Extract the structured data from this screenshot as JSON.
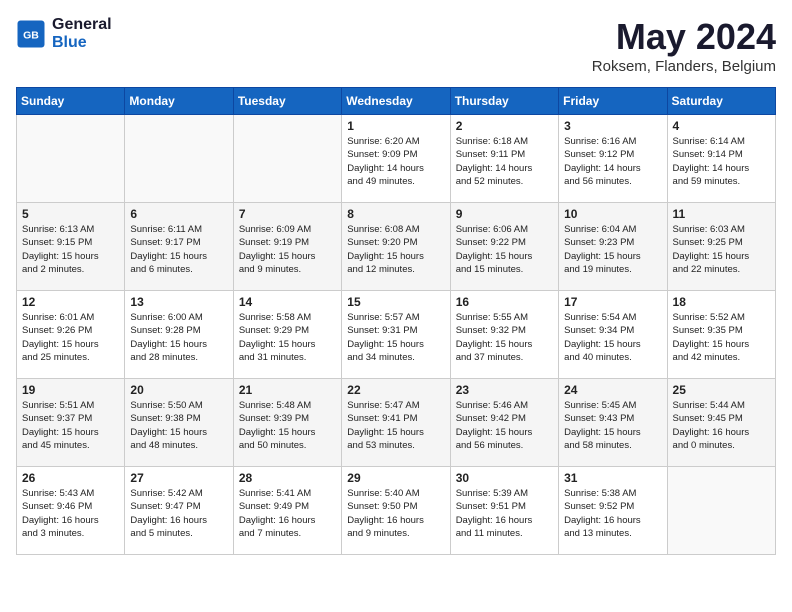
{
  "header": {
    "logo_line1": "General",
    "logo_line2": "Blue",
    "month_title": "May 2024",
    "location": "Roksem, Flanders, Belgium"
  },
  "days_of_week": [
    "Sunday",
    "Monday",
    "Tuesday",
    "Wednesday",
    "Thursday",
    "Friday",
    "Saturday"
  ],
  "weeks": [
    [
      {
        "day": "",
        "content": ""
      },
      {
        "day": "",
        "content": ""
      },
      {
        "day": "",
        "content": ""
      },
      {
        "day": "1",
        "content": "Sunrise: 6:20 AM\nSunset: 9:09 PM\nDaylight: 14 hours\nand 49 minutes."
      },
      {
        "day": "2",
        "content": "Sunrise: 6:18 AM\nSunset: 9:11 PM\nDaylight: 14 hours\nand 52 minutes."
      },
      {
        "day": "3",
        "content": "Sunrise: 6:16 AM\nSunset: 9:12 PM\nDaylight: 14 hours\nand 56 minutes."
      },
      {
        "day": "4",
        "content": "Sunrise: 6:14 AM\nSunset: 9:14 PM\nDaylight: 14 hours\nand 59 minutes."
      }
    ],
    [
      {
        "day": "5",
        "content": "Sunrise: 6:13 AM\nSunset: 9:15 PM\nDaylight: 15 hours\nand 2 minutes."
      },
      {
        "day": "6",
        "content": "Sunrise: 6:11 AM\nSunset: 9:17 PM\nDaylight: 15 hours\nand 6 minutes."
      },
      {
        "day": "7",
        "content": "Sunrise: 6:09 AM\nSunset: 9:19 PM\nDaylight: 15 hours\nand 9 minutes."
      },
      {
        "day": "8",
        "content": "Sunrise: 6:08 AM\nSunset: 9:20 PM\nDaylight: 15 hours\nand 12 minutes."
      },
      {
        "day": "9",
        "content": "Sunrise: 6:06 AM\nSunset: 9:22 PM\nDaylight: 15 hours\nand 15 minutes."
      },
      {
        "day": "10",
        "content": "Sunrise: 6:04 AM\nSunset: 9:23 PM\nDaylight: 15 hours\nand 19 minutes."
      },
      {
        "day": "11",
        "content": "Sunrise: 6:03 AM\nSunset: 9:25 PM\nDaylight: 15 hours\nand 22 minutes."
      }
    ],
    [
      {
        "day": "12",
        "content": "Sunrise: 6:01 AM\nSunset: 9:26 PM\nDaylight: 15 hours\nand 25 minutes."
      },
      {
        "day": "13",
        "content": "Sunrise: 6:00 AM\nSunset: 9:28 PM\nDaylight: 15 hours\nand 28 minutes."
      },
      {
        "day": "14",
        "content": "Sunrise: 5:58 AM\nSunset: 9:29 PM\nDaylight: 15 hours\nand 31 minutes."
      },
      {
        "day": "15",
        "content": "Sunrise: 5:57 AM\nSunset: 9:31 PM\nDaylight: 15 hours\nand 34 minutes."
      },
      {
        "day": "16",
        "content": "Sunrise: 5:55 AM\nSunset: 9:32 PM\nDaylight: 15 hours\nand 37 minutes."
      },
      {
        "day": "17",
        "content": "Sunrise: 5:54 AM\nSunset: 9:34 PM\nDaylight: 15 hours\nand 40 minutes."
      },
      {
        "day": "18",
        "content": "Sunrise: 5:52 AM\nSunset: 9:35 PM\nDaylight: 15 hours\nand 42 minutes."
      }
    ],
    [
      {
        "day": "19",
        "content": "Sunrise: 5:51 AM\nSunset: 9:37 PM\nDaylight: 15 hours\nand 45 minutes."
      },
      {
        "day": "20",
        "content": "Sunrise: 5:50 AM\nSunset: 9:38 PM\nDaylight: 15 hours\nand 48 minutes."
      },
      {
        "day": "21",
        "content": "Sunrise: 5:48 AM\nSunset: 9:39 PM\nDaylight: 15 hours\nand 50 minutes."
      },
      {
        "day": "22",
        "content": "Sunrise: 5:47 AM\nSunset: 9:41 PM\nDaylight: 15 hours\nand 53 minutes."
      },
      {
        "day": "23",
        "content": "Sunrise: 5:46 AM\nSunset: 9:42 PM\nDaylight: 15 hours\nand 56 minutes."
      },
      {
        "day": "24",
        "content": "Sunrise: 5:45 AM\nSunset: 9:43 PM\nDaylight: 15 hours\nand 58 minutes."
      },
      {
        "day": "25",
        "content": "Sunrise: 5:44 AM\nSunset: 9:45 PM\nDaylight: 16 hours\nand 0 minutes."
      }
    ],
    [
      {
        "day": "26",
        "content": "Sunrise: 5:43 AM\nSunset: 9:46 PM\nDaylight: 16 hours\nand 3 minutes."
      },
      {
        "day": "27",
        "content": "Sunrise: 5:42 AM\nSunset: 9:47 PM\nDaylight: 16 hours\nand 5 minutes."
      },
      {
        "day": "28",
        "content": "Sunrise: 5:41 AM\nSunset: 9:49 PM\nDaylight: 16 hours\nand 7 minutes."
      },
      {
        "day": "29",
        "content": "Sunrise: 5:40 AM\nSunset: 9:50 PM\nDaylight: 16 hours\nand 9 minutes."
      },
      {
        "day": "30",
        "content": "Sunrise: 5:39 AM\nSunset: 9:51 PM\nDaylight: 16 hours\nand 11 minutes."
      },
      {
        "day": "31",
        "content": "Sunrise: 5:38 AM\nSunset: 9:52 PM\nDaylight: 16 hours\nand 13 minutes."
      },
      {
        "day": "",
        "content": ""
      }
    ]
  ]
}
